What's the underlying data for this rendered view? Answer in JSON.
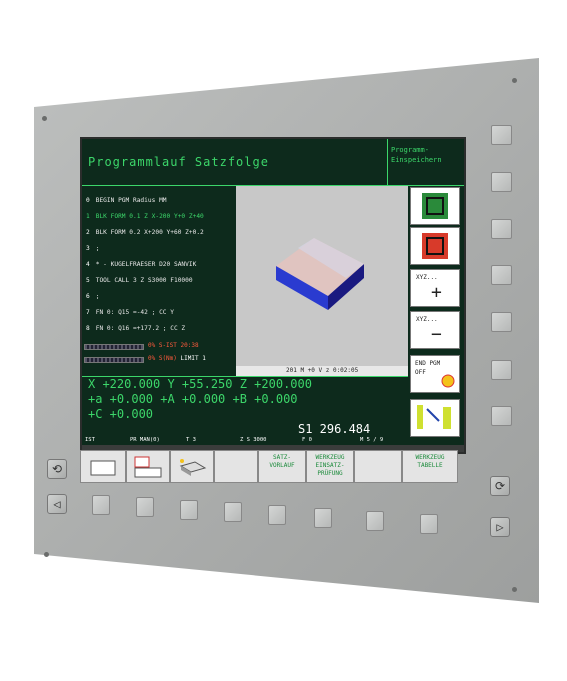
{
  "screen": {
    "title": "Programmlauf Satzfolge",
    "top_right": "Programm-Einspeichern",
    "program_lines": [
      {
        "num": "0",
        "text": "BEGIN PGM Radius MM",
        "highlight": false
      },
      {
        "num": "1",
        "text": "BLK FORM 0.1 Z  X-200  Y+0  Z+40",
        "highlight": true
      },
      {
        "num": "2",
        "text": "BLK FORM 0.2  X+200  Y+60  Z+0.2",
        "highlight": false
      },
      {
        "num": "3",
        "text": ";",
        "highlight": false
      },
      {
        "num": "4",
        "text": "* - KUGELFRAESER D20 SANVIK",
        "highlight": false
      },
      {
        "num": "5",
        "text": "TOOL CALL 3 Z S3000 F10000",
        "highlight": false
      },
      {
        "num": "6",
        "text": ";",
        "highlight": false
      },
      {
        "num": "7",
        "text": "FN 0: Q15 =-42 ; CC Y",
        "highlight": false
      },
      {
        "num": "8",
        "text": "FN 0: Q16 =+177.2 ; CC Z",
        "highlight": false
      }
    ],
    "load_line1": "0% S-IST 20:38",
    "load_line2_a": "0% S(Nm)",
    "load_line2_b": "LIMIT 1",
    "graphic_status": "201 M  +0 V z     0:02:05",
    "coords": {
      "row1": "X   +220.000  Y   +55.250  Z   +200.000",
      "row2": "+a    +0.000 +A    +0.000 +B    +0.000",
      "row3": "+C    +0.000"
    },
    "spindle": "S1  296.484",
    "status": {
      "ist": "IST",
      "pr": "PR MAN(0)",
      "t": "T 3",
      "zs": "Z S 3000",
      "f": "F 0",
      "m": "M 5 / 9"
    },
    "vertical_softkeys": [
      {
        "label": "",
        "icon": "program-run-icon"
      },
      {
        "label": "",
        "icon": "program-stop-icon"
      },
      {
        "label_top": "XYZ...",
        "label_big": "+"
      },
      {
        "label_top": "XYZ...",
        "label_big": "−"
      },
      {
        "label_top": "END PGM",
        "label_mid": "OFF",
        "icon": "clock-icon"
      },
      {
        "label": "",
        "icon": "tool-icon"
      }
    ],
    "horizontal_softkeys": [
      {
        "label": "",
        "icon": "window-icon"
      },
      {
        "label": "",
        "icon": "layout-icon"
      },
      {
        "label": "",
        "icon": "workpiece-icon"
      },
      {
        "label": ""
      },
      {
        "label": "SATZ-VORLAUF"
      },
      {
        "label": "WERKZEUG EINSATZ-PRÜFUNG"
      },
      {
        "label": ""
      },
      {
        "label": "WERKZEUG TABELLE"
      }
    ]
  },
  "colors": {
    "screen_bg": "#0d2a1c",
    "text_green": "#3cd66a",
    "panel": "#b0b2b1",
    "softkey_green": "#1a8a3a"
  }
}
